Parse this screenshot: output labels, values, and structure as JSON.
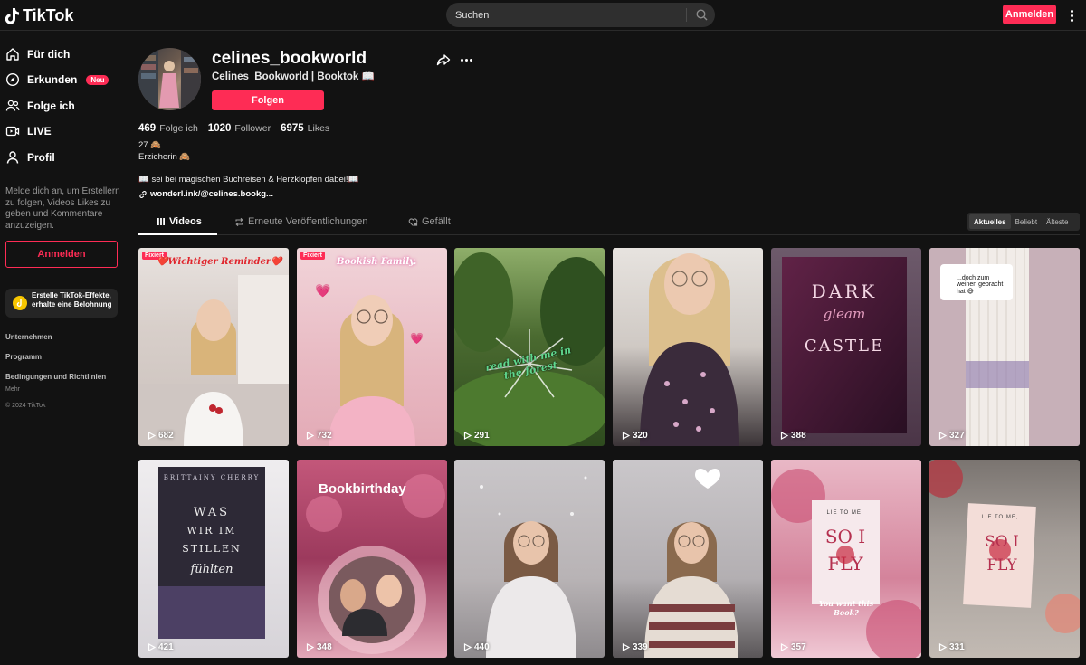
{
  "header": {
    "logo": "TikTok",
    "search_placeholder": "Suchen",
    "login_label": "Anmelden"
  },
  "sidebar": {
    "items": [
      {
        "label": "Für dich",
        "icon": "home-icon"
      },
      {
        "label": "Erkunden",
        "icon": "compass-icon",
        "badge": "Neu"
      },
      {
        "label": "Folge ich",
        "icon": "users-icon"
      },
      {
        "label": "LIVE",
        "icon": "live-icon"
      },
      {
        "label": "Profil",
        "icon": "profile-icon"
      }
    ],
    "login_hint": "Melde dich an, um Erstellern zu folgen, Videos Likes zu geben und Kommentare anzuzeigen.",
    "login_label": "Anmelden",
    "effects_text": "Erstelle TikTok-Effekte, erhalte eine Belohnung",
    "footer": {
      "company": "Unternehmen",
      "program": "Programm",
      "terms": "Bedingungen und Richtlinien",
      "more": "Mehr",
      "copyright": "© 2024 TikTok"
    }
  },
  "profile": {
    "username": "celines_bookworld",
    "nickname": "Celines_Bookworld | Booktok 📖",
    "follow_label": "Folgen",
    "stats": {
      "following": "469",
      "following_label": "Folge ich",
      "followers": "1020",
      "followers_label": "Follower",
      "likes": "6975",
      "likes_label": "Likes"
    },
    "bio": [
      "27 🙈",
      "Erzieherin 🙈",
      "📖 sei bei magischen Buchreisen & Herzklopfen dabei!📖"
    ],
    "link": "wonderl.ink/@celines.bookg..."
  },
  "tabs": {
    "videos": "Videos",
    "reposts": "Erneute Veröffentlichungen",
    "liked": "Gefällt"
  },
  "sort": [
    "Aktuelles",
    "Beliebt",
    "Älteste"
  ],
  "pinned_label": "Fixiert",
  "videos": [
    {
      "views": "682",
      "pinned": true,
      "overlay": "❤️Wichtiger Reminder❤️"
    },
    {
      "views": "732",
      "pinned": true,
      "overlay": "Bookish Family."
    },
    {
      "views": "291",
      "pinned": false,
      "overlay": "read with me in the forest"
    },
    {
      "views": "320",
      "pinned": false,
      "overlay": ""
    },
    {
      "views": "388",
      "pinned": false,
      "overlay": "DARK gleam CASTLE"
    },
    {
      "views": "327",
      "pinned": false,
      "overlay": "...doch zum weinen gebracht hat 😅"
    },
    {
      "views": "421",
      "pinned": false,
      "overlay": "WAS WIR IM STILLEN FÜHLTEN"
    },
    {
      "views": "348",
      "pinned": false,
      "overlay": "Bookbirthday"
    },
    {
      "views": "440",
      "pinned": false,
      "overlay": ""
    },
    {
      "views": "339",
      "pinned": false,
      "overlay": ""
    },
    {
      "views": "357",
      "pinned": false,
      "overlay": "You want this Book?"
    },
    {
      "views": "331",
      "pinned": false,
      "overlay": "SO I FLY"
    }
  ],
  "colors": {
    "accent": "#fe2c55",
    "background": "#121212"
  }
}
